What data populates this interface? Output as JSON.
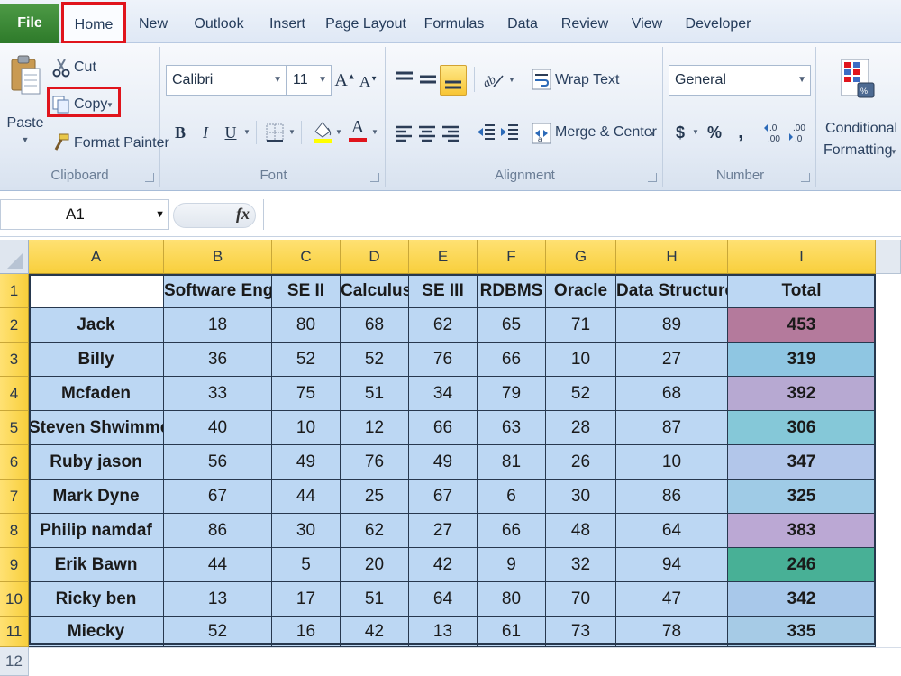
{
  "tabs": {
    "file": "File",
    "home": "Home",
    "new": "New",
    "outlook": "Outlook",
    "insert": "Insert",
    "page_layout": "Page Layout",
    "formulas": "Formulas",
    "data": "Data",
    "review": "Review",
    "view": "View",
    "developer": "Developer"
  },
  "ribbon": {
    "clipboard": {
      "label": "Clipboard",
      "paste": "Paste",
      "cut": "Cut",
      "copy": "Copy",
      "format_painter": "Format Painter"
    },
    "font": {
      "label": "Font",
      "font_name": "Calibri",
      "font_size": "11",
      "bold": "B",
      "italic": "I",
      "underline": "U",
      "font_color_letter": "A"
    },
    "alignment": {
      "label": "Alignment",
      "wrap_text": "Wrap Text",
      "merge_center": "Merge & Center"
    },
    "number": {
      "label": "Number",
      "format": "General",
      "currency": "$",
      "percent": "%",
      "comma": ","
    },
    "styles": {
      "conditional_1": "Conditional",
      "conditional_2": "Formatting"
    }
  },
  "formula_bar": {
    "name_box": "A1",
    "fx": "fx",
    "value": ""
  },
  "colors": {
    "accent_red": "#e0141c",
    "header_yellow": "#f8cf3c",
    "cell_blue": "#bcd7f3"
  },
  "sheet": {
    "column_letters": [
      "A",
      "B",
      "C",
      "D",
      "E",
      "F",
      "G",
      "H",
      "I"
    ],
    "row_numbers": [
      "1",
      "2",
      "3",
      "4",
      "5",
      "6",
      "7",
      "8",
      "9",
      "10",
      "11",
      "12"
    ],
    "headers": [
      "",
      "Software Engg",
      "SE II",
      "Calculus",
      "SE III",
      "RDBMS",
      "Oracle",
      "Data Structure",
      "Total"
    ],
    "rows": [
      {
        "name": "Jack",
        "scores": [
          "18",
          "80",
          "68",
          "62",
          "65",
          "71",
          "89"
        ],
        "total": "453",
        "total_color": "#b47a9c"
      },
      {
        "name": "Billy",
        "scores": [
          "36",
          "52",
          "52",
          "76",
          "66",
          "10",
          "27"
        ],
        "total": "319",
        "total_color": "#8fc6e2"
      },
      {
        "name": "Mcfaden",
        "scores": [
          "33",
          "75",
          "51",
          "34",
          "79",
          "52",
          "68"
        ],
        "total": "392",
        "total_color": "#b7a9d2"
      },
      {
        "name": "Steven Shwimmer",
        "scores": [
          "40",
          "10",
          "12",
          "66",
          "63",
          "28",
          "87"
        ],
        "total": "306",
        "total_color": "#85c8d8"
      },
      {
        "name": "Ruby jason",
        "scores": [
          "56",
          "49",
          "76",
          "49",
          "81",
          "26",
          "10"
        ],
        "total": "347",
        "total_color": "#b2c6ea"
      },
      {
        "name": "Mark Dyne",
        "scores": [
          "67",
          "44",
          "25",
          "67",
          "6",
          "30",
          "86"
        ],
        "total": "325",
        "total_color": "#9fcbe6"
      },
      {
        "name": "Philip namdaf",
        "scores": [
          "86",
          "30",
          "62",
          "27",
          "66",
          "48",
          "64"
        ],
        "total": "383",
        "total_color": "#bba8d4"
      },
      {
        "name": "Erik Bawn",
        "scores": [
          "44",
          "5",
          "20",
          "42",
          "9",
          "32",
          "94"
        ],
        "total": "246",
        "total_color": "#48b096"
      },
      {
        "name": "Ricky ben",
        "scores": [
          "13",
          "17",
          "51",
          "64",
          "80",
          "70",
          "47"
        ],
        "total": "342",
        "total_color": "#a8c8ea"
      },
      {
        "name": "Miecky",
        "scores": [
          "52",
          "16",
          "42",
          "13",
          "61",
          "73",
          "78"
        ],
        "total": "335",
        "total_color": "#a6cbe6"
      }
    ]
  }
}
